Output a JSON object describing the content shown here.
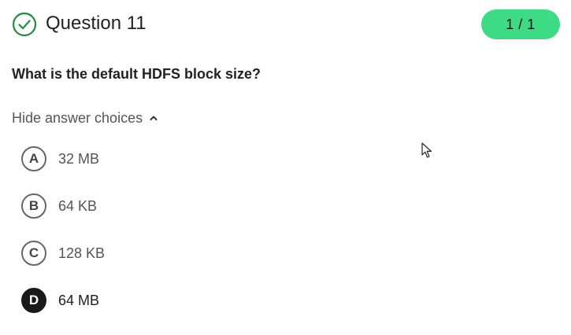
{
  "question": {
    "title": "Question 11",
    "score": "1 / 1",
    "status_icon": "check-circle-icon",
    "prompt": "What is the default HDFS block size?"
  },
  "answers": {
    "toggle_label": "Hide answer choices",
    "toggle_icon": "chevron-up-icon",
    "choices": [
      {
        "letter": "A",
        "text": "32 MB",
        "selected": false
      },
      {
        "letter": "B",
        "text": "64 KB",
        "selected": false
      },
      {
        "letter": "C",
        "text": "128 KB",
        "selected": false
      },
      {
        "letter": "D",
        "text": "64 MB",
        "selected": true
      }
    ]
  },
  "colors": {
    "accent_green": "#3ddc84",
    "check_green": "#1e8e3e",
    "selected_fill": "#1a1a1a"
  }
}
